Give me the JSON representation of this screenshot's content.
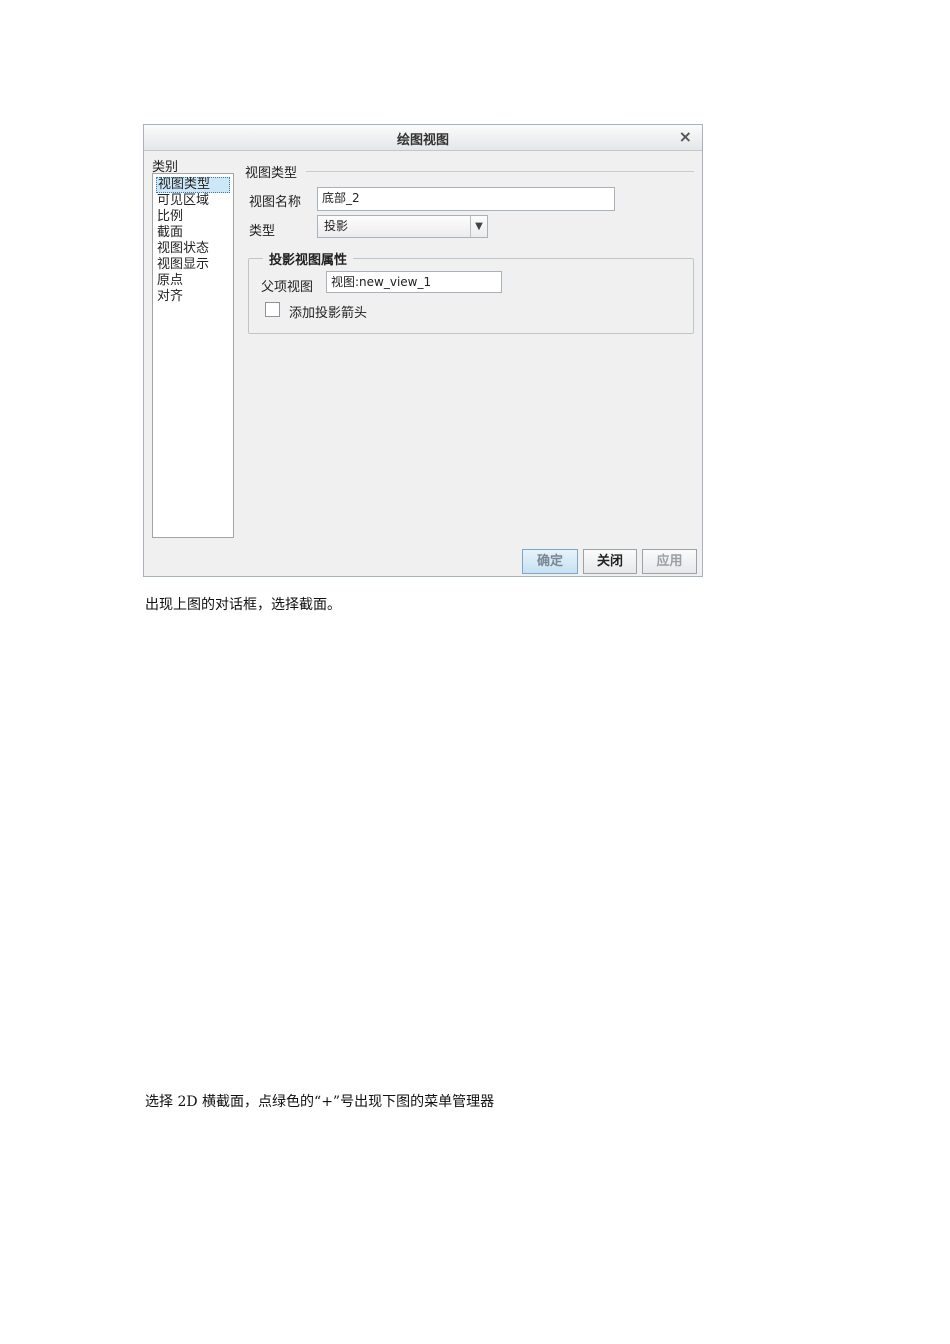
{
  "dialog": {
    "title": "绘图视图",
    "close_glyph": "×",
    "category_label": "类别",
    "categories": [
      "视图类型",
      "可见区域",
      "比例",
      "截面",
      "视图状态",
      "视图显示",
      "原点",
      "对齐"
    ],
    "selected_category": "视图类型",
    "section_title": "视图类型",
    "view_name_label": "视图名称",
    "view_name_value": "底部_2",
    "type_label": "类型",
    "type_value": "投影",
    "group_title": "投影视图属性",
    "parent_view_label": "父项视图",
    "parent_view_value": "视图:new_view_1",
    "add_arrow_label": "添加投影箭头",
    "add_arrow_checked": false,
    "buttons": {
      "ok": "确定",
      "close": "关闭",
      "apply": "应用"
    }
  },
  "captions": {
    "first": "出现上图的对话框，选择截面。",
    "second": "选择 2D 横截面，点绿色的“+”号出现下图的菜单管理器"
  }
}
